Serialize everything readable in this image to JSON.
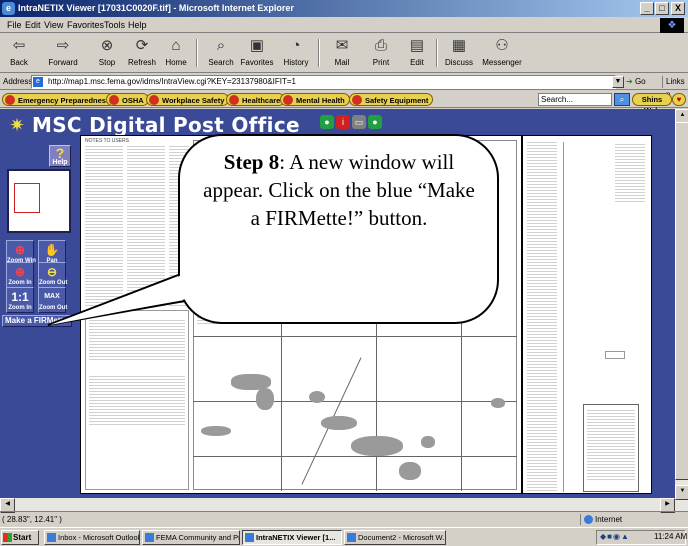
{
  "window": {
    "title": "IntraNETIX Viewer [17031C0020F.tif] - Microsoft Internet Explorer",
    "buttons": [
      "_",
      "□",
      "X"
    ]
  },
  "menu": [
    "File",
    "Edit",
    "View",
    "Favorites",
    "Tools",
    "Help"
  ],
  "toolbar": [
    {
      "label": "Back",
      "icon": "back-arrow-icon"
    },
    {
      "label": "Forward",
      "icon": "forward-arrow-icon"
    },
    {
      "label": "Stop",
      "icon": "stop-icon"
    },
    {
      "label": "Refresh",
      "icon": "refresh-icon"
    },
    {
      "label": "Home",
      "icon": "home-icon"
    },
    {
      "label": "Search",
      "icon": "search-icon"
    },
    {
      "label": "Favorites",
      "icon": "favorites-icon"
    },
    {
      "label": "History",
      "icon": "history-icon"
    },
    {
      "label": "Mail",
      "icon": "mail-icon"
    },
    {
      "label": "Print",
      "icon": "print-icon"
    },
    {
      "label": "Edit",
      "icon": "edit-icon"
    },
    {
      "label": "Discuss",
      "icon": "discuss-icon"
    },
    {
      "label": "Messenger",
      "icon": "messenger-icon"
    }
  ],
  "address": {
    "label": "Address",
    "url": "http://map1.msc.fema.gov/idms/IntraView.cgi?KEY=23137980&IFIT=1",
    "go": "Go",
    "links": "Links »"
  },
  "links_bar": [
    "Emergency Preparedness",
    "OSHA",
    "Workplace Safety",
    "Healthcare",
    "Mental Health",
    "Safety Equipment"
  ],
  "search_box": "Search...",
  "shins_web": "Shins Web",
  "msc": {
    "title": "MSC Digital Post Office",
    "help": "Help",
    "zoom_win": "Zoom Win",
    "pan": "Pan",
    "zoom_in": "Zoom In",
    "zoom_out": "Zoom Out",
    "one_to_one": "1:1",
    "max": "MAX",
    "make_firmette": "Make a FIRMette"
  },
  "map": {
    "notes_title": "NOTES TO USERS"
  },
  "callout": {
    "step": "Step 8",
    "text": ": A new window will appear. Click on the blue “Make a FIRMette!” button."
  },
  "status": {
    "coords": "( 28.83\", 12.41\" )",
    "zone": "Internet"
  },
  "taskbar": {
    "start": "Start",
    "tasks": [
      {
        "label": "Inbox - Microsoft Outlook",
        "active": false
      },
      {
        "label": "FEMA Community and Pro...",
        "active": false
      },
      {
        "label": "IntraNETIX Viewer [1...",
        "active": true
      },
      {
        "label": "Document2 - Microsoft W...",
        "active": false
      }
    ],
    "clock": "11:24 AM"
  }
}
